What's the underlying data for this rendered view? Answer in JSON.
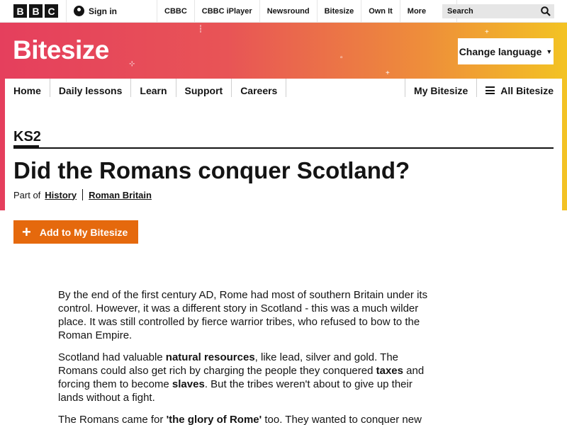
{
  "topbar": {
    "logo_letters": [
      "B",
      "B",
      "C"
    ],
    "signin_label": "Sign in",
    "links": [
      "CBBC",
      "CBBC iPlayer",
      "Newsround",
      "Bitesize",
      "Own It"
    ],
    "more_label": "More",
    "search_placeholder": "Search"
  },
  "brand": {
    "name": "Bitesize",
    "change_language": "Change language"
  },
  "mainnav": {
    "items": [
      "Home",
      "Daily lessons",
      "Learn",
      "Support",
      "Careers"
    ],
    "my_bitesize": "My Bitesize",
    "all_bitesize": "All Bitesize"
  },
  "page": {
    "level": "KS2",
    "title": "Did the Romans conquer Scotland?",
    "part_of": "Part of",
    "breadcrumb": [
      "History",
      "Roman Britain"
    ],
    "add_button": "Add to My Bitesize"
  },
  "article": {
    "p1": "By the end of the first century AD, Rome had most of southern Britain under its control. However, it was a different story in Scotland - this was a much wilder place. It was still controlled by fierce warrior tribes, who refused to bow to the Roman Empire.",
    "p2_a": "Scotland had valuable ",
    "p2_b": "natural resources",
    "p2_c": ", like lead, silver and gold. The Romans could also get rich by charging the people they conquered ",
    "p2_d": "taxes",
    "p2_e": " and forcing them to become ",
    "p2_f": "slaves",
    "p2_g": ". But the tribes weren't about to give up their lands without a fight.",
    "p3_a": "The Romans came for ",
    "p3_b": "'the glory of Rome'",
    "p3_c": " too. They wanted to conquer new"
  },
  "colors": {
    "gradient_start": "#e53f5d",
    "gradient_end": "#f3c323",
    "add_button": "#e5690d"
  }
}
